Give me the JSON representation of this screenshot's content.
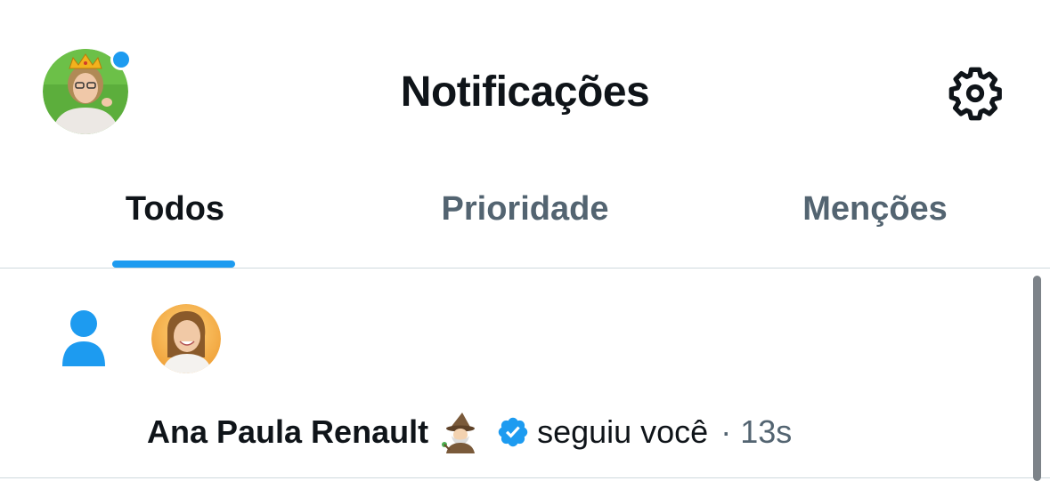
{
  "header": {
    "title": "Notificações",
    "avatar_icon": "user-avatar-with-crown",
    "settings_icon": "gear-icon",
    "status_dot_color": "#1d9bf0"
  },
  "tabs": [
    {
      "label": "Todos",
      "active": true
    },
    {
      "label": "Prioridade",
      "active": false
    },
    {
      "label": "Menções",
      "active": false
    }
  ],
  "notifications": [
    {
      "type_icon": "person-icon",
      "user_name": "Ana Paula Renault",
      "name_emoji": "🧙🏼",
      "verified": true,
      "action": "seguiu você",
      "separator": "·",
      "time": "13s"
    }
  ],
  "colors": {
    "accent": "#1d9bf0",
    "text_primary": "#0f1419",
    "text_secondary": "#536471",
    "border": "#cfd9de"
  }
}
